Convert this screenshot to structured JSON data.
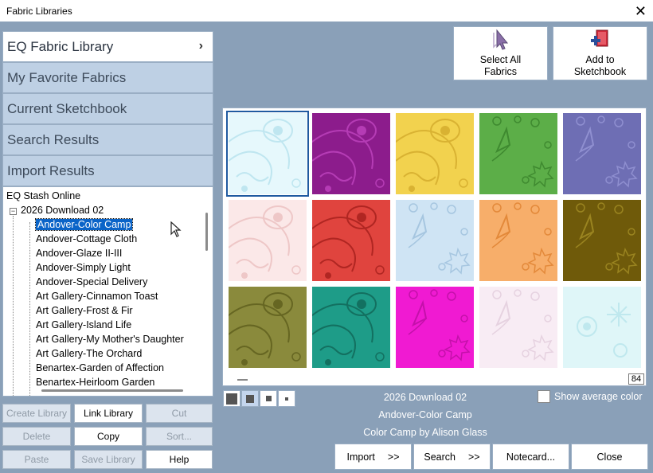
{
  "window": {
    "title": "Fabric Libraries"
  },
  "library_tabs": [
    {
      "label": "EQ Fabric Library",
      "active": true
    },
    {
      "label": "My Favorite Fabrics",
      "active": false
    },
    {
      "label": "Current Sketchbook",
      "active": false
    },
    {
      "label": "Search Results",
      "active": false
    },
    {
      "label": "Import Results",
      "active": false
    }
  ],
  "tree": {
    "root": "EQ Stash Online",
    "group": "2026 Download 02",
    "toggle": "−",
    "items": [
      "Andover-Color Camp",
      "Andover-Cottage Cloth",
      "Andover-Glaze II-III",
      "Andover-Simply Light",
      "Andover-Special Delivery",
      "Art Gallery-Cinnamon Toast",
      "Art Gallery-Frost & Fir",
      "Art Gallery-Island Life",
      "Art Gallery-My Mother's Daughter",
      "Art Gallery-The Orchard",
      "Benartex-Garden of Affection",
      "Benartex-Heirloom Garden"
    ],
    "selected": "Andover-Color Camp"
  },
  "library_buttons": [
    {
      "label": "Create Library",
      "enabled": false
    },
    {
      "label": "Link Library",
      "enabled": true
    },
    {
      "label": "Cut",
      "enabled": false
    },
    {
      "label": "Delete",
      "enabled": false
    },
    {
      "label": "Copy",
      "enabled": true
    },
    {
      "label": "Sort...",
      "enabled": false
    },
    {
      "label": "Paste",
      "enabled": false
    },
    {
      "label": "Save Library",
      "enabled": false
    },
    {
      "label": "Help",
      "enabled": true
    }
  ],
  "toolbar": {
    "select_all": "Select All\nFabrics",
    "add_sketchbook": "Add to\nSketchbook"
  },
  "swatches": [
    {
      "color": "#e6f8fc",
      "motif": "#bfe6f0",
      "variant": "swirl",
      "selected": true
    },
    {
      "color": "#8c1c8c",
      "motif": "#b53cb5",
      "variant": "swirl"
    },
    {
      "color": "#f2d24e",
      "motif": "#d9b232",
      "variant": "swirl"
    },
    {
      "color": "#5cae48",
      "motif": "#3f8a30",
      "variant": "arrow"
    },
    {
      "color": "#6e6eb4",
      "motif": "#8f8fd0",
      "variant": "arrow"
    },
    {
      "color": "#fbe8e8",
      "motif": "#eec7c7",
      "variant": "swirl"
    },
    {
      "color": "#e0443e",
      "motif": "#b02622",
      "variant": "swirl"
    },
    {
      "color": "#cfe4f4",
      "motif": "#a6c6e0",
      "variant": "arrow"
    },
    {
      "color": "#f7ae6a",
      "motif": "#e3893a",
      "variant": "arrow"
    },
    {
      "color": "#6f5a0a",
      "motif": "#9a8420",
      "variant": "arrow"
    },
    {
      "color": "#8a8a3c",
      "motif": "#666622",
      "variant": "swirl"
    },
    {
      "color": "#1e9c88",
      "motif": "#137060",
      "variant": "swirl"
    },
    {
      "color": "#f01ad2",
      "motif": "#c410aa",
      "variant": "arrow"
    },
    {
      "color": "#f8ecf4",
      "motif": "#e6d2e0",
      "variant": "arrow"
    },
    {
      "color": "#dff6f8",
      "motif": "#bfe8ee",
      "variant": "flower"
    }
  ],
  "grid_counter": "84",
  "info": {
    "library": "2026 Download 02",
    "collection": "Andover-Color Camp",
    "designer": "Color Camp by Alison Glass"
  },
  "avg_color": {
    "label": "Show average color",
    "checked": false
  },
  "actions": {
    "import": "Import",
    "search": "Search",
    "notecard": "Notecard...",
    "close": "Close",
    "more": ">>"
  },
  "icons": {
    "close": "close-icon",
    "chevron": "chevron-right-icon"
  }
}
